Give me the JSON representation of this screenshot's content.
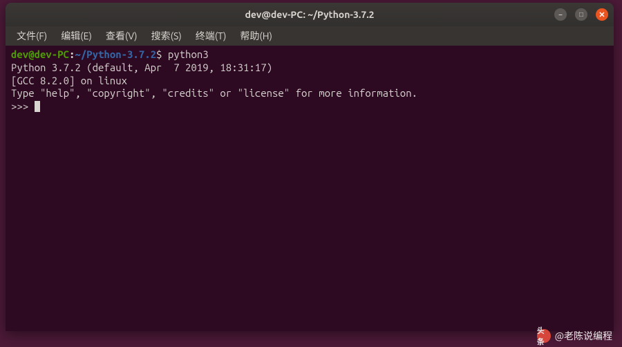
{
  "window": {
    "title": "dev@dev-PC: ~/Python-3.7.2"
  },
  "menu": {
    "file": "文件(F)",
    "edit": "编辑(E)",
    "view": "查看(V)",
    "search": "搜索(S)",
    "term": "终端(T)",
    "help": "帮助(H)"
  },
  "prompt": {
    "user_host": "dev@dev-PC",
    "colon": ":",
    "path": "~/Python-3.7.2",
    "dollar": "$",
    "command": " python3"
  },
  "output": {
    "line1": "Python 3.7.2 (default, Apr  7 2019, 18:31:17)",
    "line2": "[GCC 8.2.0] on linux",
    "line3": "Type \"help\", \"copyright\", \"credits\" or \"license\" for more information.",
    "repl_prompt": ">>> "
  },
  "controls": {
    "min": "–",
    "max": "□",
    "close": "✕"
  },
  "watermark": {
    "icon_text": "头条",
    "text": "@老陈说编程"
  }
}
